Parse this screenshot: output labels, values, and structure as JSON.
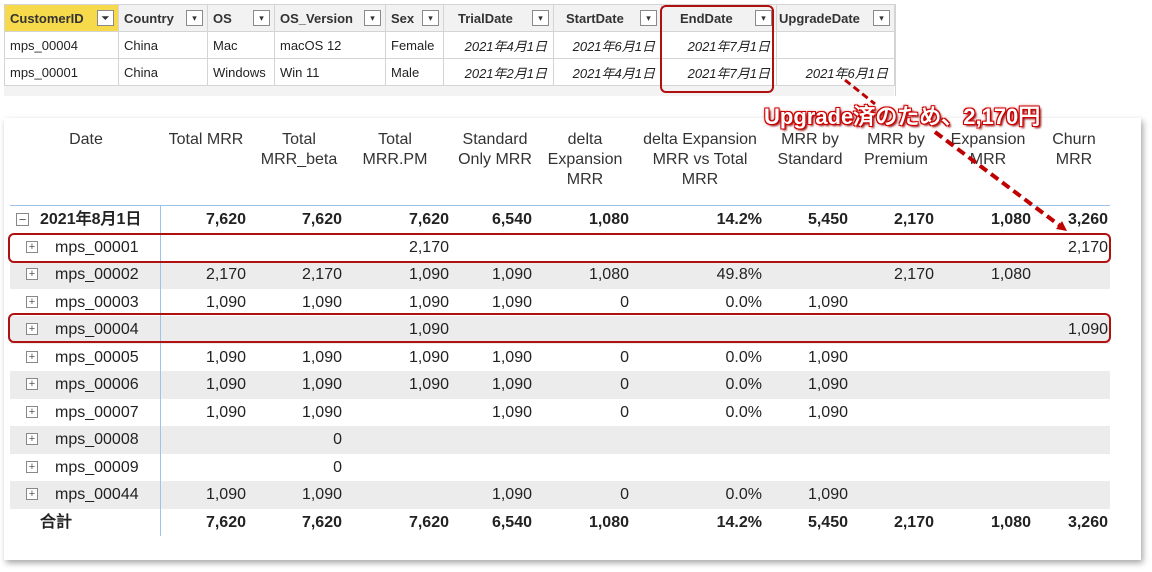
{
  "excel": {
    "headers": [
      "CustomerID",
      "Country",
      "OS",
      "OS_Version",
      "Sex",
      "TrialDate",
      "StartDate",
      "EndDate",
      "UpgradeDate"
    ],
    "rows": [
      [
        "mps_00004",
        "China",
        "Mac",
        "macOS 12",
        "Female",
        "2021年4月1日",
        "2021年6月1日",
        "2021年7月1日",
        ""
      ],
      [
        "mps_00001",
        "China",
        "Windows",
        "Win 11",
        "Male",
        "2021年2月1日",
        "2021年4月1日",
        "2021年7月1日",
        "2021年6月1日"
      ]
    ],
    "sorted_column": "CustomerID"
  },
  "matrix": {
    "headers": [
      "Date",
      "Total MRR",
      "Total MRR_beta",
      "Total MRR.PM",
      "Standard Only MRR",
      "delta Expansion MRR",
      "delta Expansion MRR vs Total MRR",
      "MRR by Standard",
      "MRR by Premium",
      "Expansion MRR",
      "Churn MRR"
    ],
    "group": {
      "label": "2021年8月1日",
      "values": [
        "7,620",
        "7,620",
        "7,620",
        "6,540",
        "1,080",
        "14.2%",
        "5,450",
        "2,170",
        "1,080",
        "3,260"
      ]
    },
    "rows": [
      {
        "label": "mps_00001",
        "values": [
          "",
          "",
          "2,170",
          "",
          "",
          "",
          "",
          "",
          "",
          "2,170"
        ]
      },
      {
        "label": "mps_00002",
        "values": [
          "2,170",
          "2,170",
          "1,090",
          "1,090",
          "1,080",
          "49.8%",
          "",
          "2,170",
          "1,080",
          ""
        ]
      },
      {
        "label": "mps_00003",
        "values": [
          "1,090",
          "1,090",
          "1,090",
          "1,090",
          "0",
          "0.0%",
          "1,090",
          "",
          "",
          ""
        ]
      },
      {
        "label": "mps_00004",
        "values": [
          "",
          "",
          "1,090",
          "",
          "",
          "",
          "",
          "",
          "",
          "1,090"
        ]
      },
      {
        "label": "mps_00005",
        "values": [
          "1,090",
          "1,090",
          "1,090",
          "1,090",
          "0",
          "0.0%",
          "1,090",
          "",
          "",
          ""
        ]
      },
      {
        "label": "mps_00006",
        "values": [
          "1,090",
          "1,090",
          "1,090",
          "1,090",
          "0",
          "0.0%",
          "1,090",
          "",
          "",
          ""
        ]
      },
      {
        "label": "mps_00007",
        "values": [
          "1,090",
          "1,090",
          "",
          "1,090",
          "0",
          "0.0%",
          "1,090",
          "",
          "",
          ""
        ]
      },
      {
        "label": "mps_00008",
        "values": [
          "",
          "0",
          "",
          "",
          "",
          "",
          "",
          "",
          "",
          ""
        ]
      },
      {
        "label": "mps_00009",
        "values": [
          "",
          "0",
          "",
          "",
          "",
          "",
          "",
          "",
          "",
          ""
        ]
      },
      {
        "label": "mps_00044",
        "values": [
          "1,090",
          "1,090",
          "",
          "1,090",
          "0",
          "0.0%",
          "1,090",
          "",
          "",
          ""
        ]
      }
    ],
    "total": {
      "label": "合計",
      "values": [
        "7,620",
        "7,620",
        "7,620",
        "6,540",
        "1,080",
        "14.2%",
        "5,450",
        "2,170",
        "1,080",
        "3,260"
      ]
    }
  },
  "annotation": {
    "callout_text": "Upgrade済のため、2,170円",
    "color": "#b01010"
  },
  "colors": {
    "sorted_header": "#f7d94c",
    "row_alt": "#ececec",
    "divider": "#9ec3e6"
  }
}
